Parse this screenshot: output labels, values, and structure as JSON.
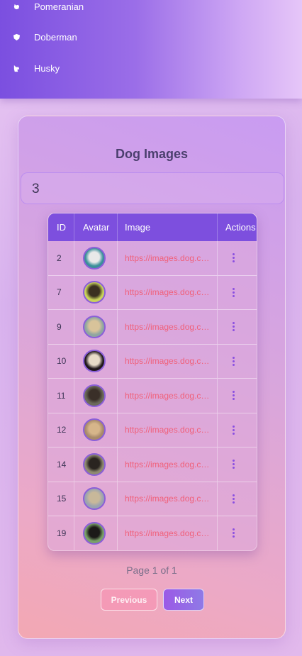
{
  "nav": {
    "items": [
      {
        "label": "Pomeranian",
        "icon": "dog-icon"
      },
      {
        "label": "Doberman",
        "icon": "shield-dog-icon"
      },
      {
        "label": "Husky",
        "icon": "wolf-icon"
      }
    ]
  },
  "card": {
    "title": "Dog Images",
    "search_value": "3"
  },
  "table": {
    "headers": [
      "ID",
      "Avatar",
      "Image",
      "Actions"
    ],
    "rows": [
      {
        "id": "2",
        "image": "https://images.dog.ceo/..."
      },
      {
        "id": "7",
        "image": "https://images.dog.ceo/..."
      },
      {
        "id": "9",
        "image": "https://images.dog.ceo/..."
      },
      {
        "id": "10",
        "image": "https://images.dog.ceo/..."
      },
      {
        "id": "11",
        "image": "https://images.dog.ceo/..."
      },
      {
        "id": "12",
        "image": "https://images.dog.ceo/..."
      },
      {
        "id": "14",
        "image": "https://images.dog.ceo/..."
      },
      {
        "id": "15",
        "image": "https://images.dog.ceo/..."
      },
      {
        "id": "19",
        "image": "https://images.dog.ceo/..."
      }
    ]
  },
  "pagination": {
    "info": "Page 1 of 1",
    "prev_label": "Previous",
    "next_label": "Next"
  },
  "colors": {
    "accent": "#7d4fde",
    "link": "#f0607a"
  }
}
